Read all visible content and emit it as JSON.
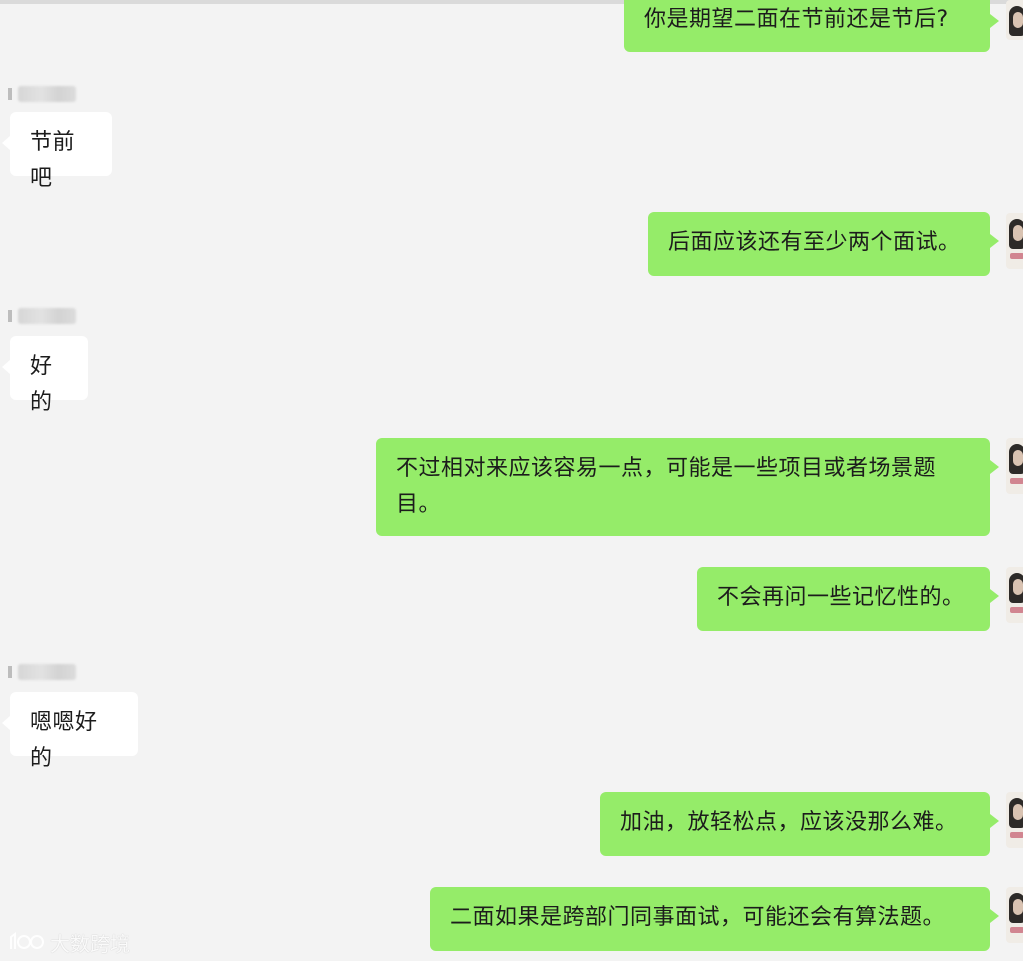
{
  "chat": {
    "messages": [
      {
        "side": "out",
        "text": "你是期望二面在节前还是节后?"
      },
      {
        "side": "in",
        "text": "节前吧"
      },
      {
        "side": "out",
        "text": "后面应该还有至少两个面试。"
      },
      {
        "side": "in",
        "text": "好的"
      },
      {
        "side": "out",
        "text": "不过相对来应该容易一点，可能是一些项目或者场景题目。"
      },
      {
        "side": "out",
        "text": "不会再问一些记忆性的。"
      },
      {
        "side": "in",
        "text": "嗯嗯好的"
      },
      {
        "side": "out",
        "text": "加油，放轻松点，应该没那么难。"
      },
      {
        "side": "out",
        "text": "二面如果是跨部门同事面试，可能还会有算法题。"
      }
    ]
  },
  "watermark": {
    "text": "大数跨境"
  },
  "colors": {
    "background": "#f3f3f3",
    "outgoing_bubble": "#95ec69",
    "incoming_bubble": "#ffffff"
  }
}
